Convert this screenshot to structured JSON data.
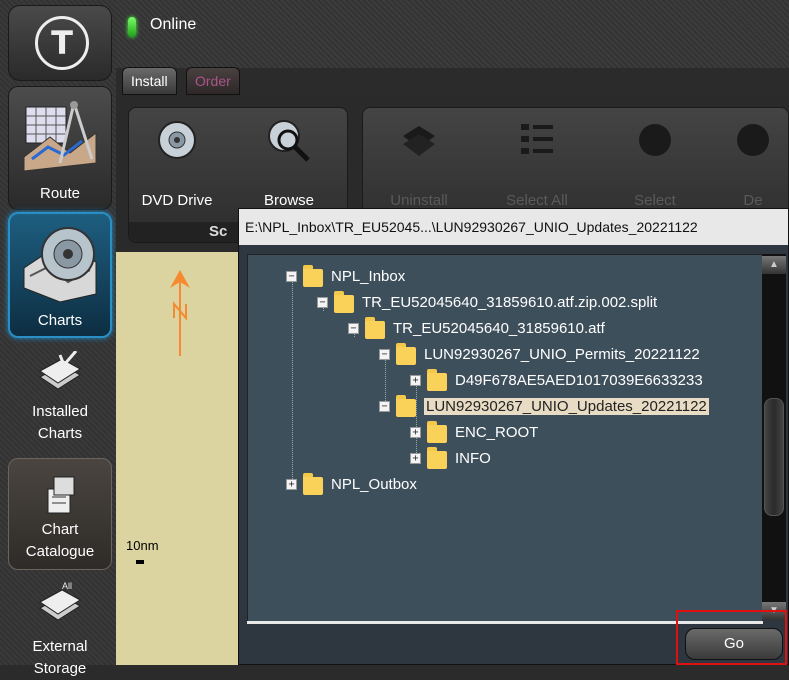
{
  "status": {
    "text": "Online",
    "led_color": "#3ddc2a"
  },
  "tabs": [
    {
      "label": "Install"
    },
    {
      "label": "Order"
    }
  ],
  "toolbar": {
    "dvd_label": "DVD Drive",
    "browse_label": "Browse",
    "group_label": "Sc",
    "uninstall_label": "Uninstall",
    "select_all_label": "Select All",
    "select_label": "Select",
    "de_label": "De"
  },
  "sidebar": {
    "route": "Route",
    "charts": "Charts",
    "installed": [
      "Installed",
      "Charts"
    ],
    "catalogue": [
      "Chart",
      "Catalogue"
    ],
    "external": [
      "External",
      "Storage"
    ],
    "external_badge": "All"
  },
  "map": {
    "scale_label": "10nm",
    "bg_color": "#dcd4a0"
  },
  "dialog": {
    "path": "E:\\NPL_Inbox\\TR_EU52045...\\LUN92930267_UNIO_Updates_20221122",
    "go_label": "Go"
  },
  "tree": {
    "npl_inbox": "NPL_Inbox",
    "split": "TR_EU52045640_31859610.atf.zip.002.split",
    "atf": "TR_EU52045640_31859610.atf",
    "permits": "LUN92930267_UNIO_Permits_20221122",
    "guid": "D49F678AE5AED1017039E6633233",
    "updates": "LUN92930267_UNIO_Updates_20221122",
    "enc_root": "ENC_ROOT",
    "info": "INFO",
    "npl_outbox": "NPL_Outbox"
  },
  "colors": {
    "highlight": "#e01010",
    "charts_accent": "#2a8fc4",
    "tree_bg": "#3e4f5c"
  }
}
